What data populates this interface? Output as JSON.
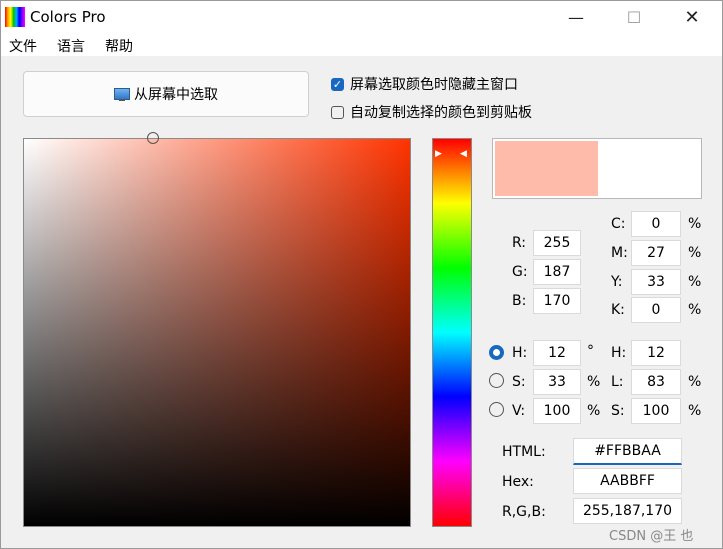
{
  "window": {
    "title": "Colors Pro",
    "controls": {
      "minimize": "—",
      "maximize": "☐",
      "close": "✕"
    }
  },
  "menu": [
    "文件",
    "语言",
    "帮助"
  ],
  "pick_button": {
    "label": "从屏幕中选取",
    "icon": "monitor-icon"
  },
  "options": [
    {
      "label": "屏幕选取颜色时隐藏主窗口",
      "checked": true
    },
    {
      "label": "自动复制选择的颜色到剪贴板",
      "checked": false
    }
  ],
  "current_color": "#FFBBAA",
  "hue_base_color": "#ff3300",
  "rgb": {
    "r_label": "R:",
    "g_label": "G:",
    "b_label": "B:",
    "r": "255",
    "g": "187",
    "b": "170"
  },
  "cmyk": {
    "c_label": "C:",
    "m_label": "M:",
    "y_label": "Y:",
    "k_label": "K:",
    "c": "0",
    "m": "27",
    "y": "33",
    "k": "0",
    "unit": "%"
  },
  "hsv": {
    "h_label": "H:",
    "s_label": "S:",
    "v_label": "V:",
    "h": "12",
    "s": "33",
    "v": "100",
    "h_unit": "°",
    "s_unit": "%",
    "v_unit": "%",
    "selected": "H"
  },
  "hsl": {
    "h_label": "H:",
    "l_label": "L:",
    "s_label": "S:",
    "h": "12",
    "l": "83",
    "s": "100",
    "unit": "%"
  },
  "codes": {
    "html_label": "HTML:",
    "html": "#FFBBAA",
    "hex_label": "Hex:",
    "hex": "AABBFF",
    "rgb_label": "R,G,B:",
    "rgb": "255,187,170"
  },
  "watermark": "CSDN @王    也"
}
